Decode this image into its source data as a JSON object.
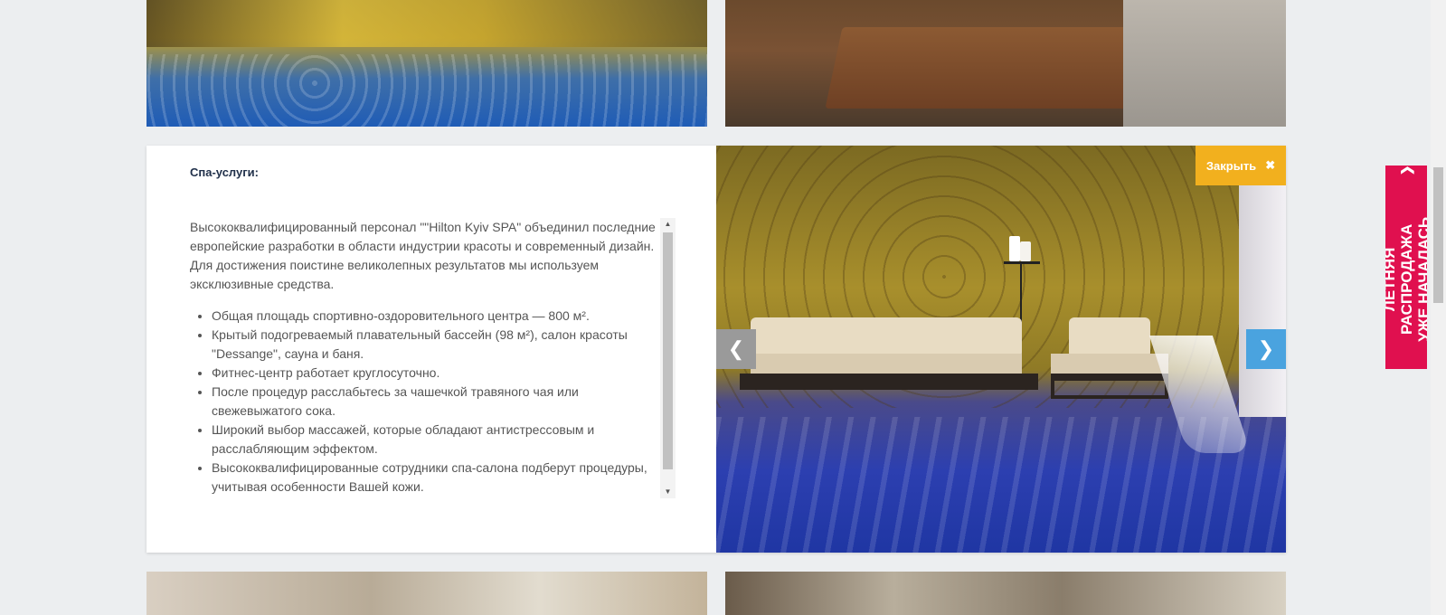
{
  "detail": {
    "heading": "Спа-услуги:",
    "intro": "Высококвалифицированный персонал \"\"Hilton Kyiv SPA\" объединил последние европейские разработки в области индустрии красоты и современный дизайн. Для достижения поистине великолепных результатов мы используем эксклюзивные средства.",
    "features": [
      "Общая площадь спортивно-оздоровительного центра — 800 м².",
      "Крытый подогреваемый плавательный бассейн (98 м²), салон красоты \"Dessange\", сауна и баня.",
      "Фитнес-центр работает круглосуточно.",
      "После процедур расслабьтесь за чашечкой травяного чая или свежевыжатого сока.",
      "Широкий выбор массажей, которые обладают антистрессовым и расслабляющим эффектом.",
      "Высококвалифицированные сотрудники спа-салона подберут процедуры, учитывая особенности Вашей кожи."
    ]
  },
  "gallery": {
    "close_label": "Закрыть",
    "close_icon": "close-icon",
    "prev_icon": "chevron-left-icon",
    "next_icon": "chevron-right-icon"
  },
  "sale_tab": {
    "line1": "ЛЕТНЯЯ РАСПРОДАЖА",
    "line2": "УЖЕ НАЧАЛАСЬ",
    "icon": "chevron-up-icon"
  },
  "colors": {
    "accent_close": "#f2b01e",
    "accent_next": "#4aa3df",
    "sale_tab": "#e0104f",
    "heading": "#20304a"
  }
}
